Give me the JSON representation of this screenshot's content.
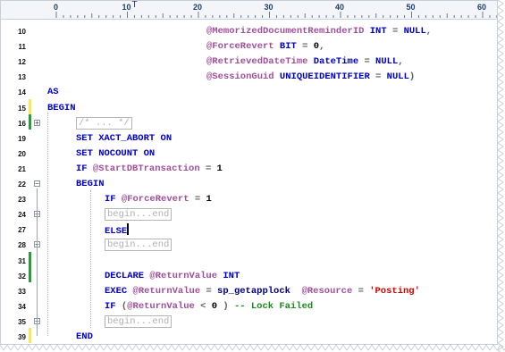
{
  "ruler": {
    "labels": [
      "0",
      "10",
      "20",
      "30",
      "40",
      "50",
      "60"
    ],
    "marker": "T"
  },
  "lines": [
    {
      "num": "10",
      "bar": "none",
      "fold": "",
      "indent": 230,
      "tokens": [
        {
          "c": "var",
          "t": "@MemorizedDocumentReminderID"
        },
        {
          "c": "kw",
          "t": " INT "
        },
        {
          "c": "op",
          "t": "="
        },
        {
          "c": "kw",
          "t": " NULL"
        },
        {
          "c": "op",
          "t": ","
        }
      ]
    },
    {
      "num": "11",
      "bar": "none",
      "fold": "",
      "indent": 230,
      "tokens": [
        {
          "c": "var",
          "t": "@ForceRevert"
        },
        {
          "c": "kw",
          "t": " BIT "
        },
        {
          "c": "op",
          "t": "="
        },
        {
          "c": "num",
          "t": " 0"
        },
        {
          "c": "op",
          "t": ","
        }
      ]
    },
    {
      "num": "12",
      "bar": "none",
      "fold": "",
      "indent": 230,
      "tokens": [
        {
          "c": "var",
          "t": "@RetrievedDateTime"
        },
        {
          "c": "kw",
          "t": " DateTime "
        },
        {
          "c": "op",
          "t": "="
        },
        {
          "c": "kw",
          "t": " NULL"
        },
        {
          "c": "op",
          "t": ","
        }
      ]
    },
    {
      "num": "13",
      "bar": "none",
      "fold": "",
      "indent": 230,
      "tokens": [
        {
          "c": "var",
          "t": "@SessionGuid"
        },
        {
          "c": "kw",
          "t": " UNIQUEIDENTIFIER "
        },
        {
          "c": "op",
          "t": "="
        },
        {
          "c": "kw",
          "t": " NULL"
        },
        {
          "c": "op",
          "t": ")"
        }
      ]
    },
    {
      "num": "14",
      "bar": "none",
      "fold": "",
      "indent": 52,
      "tokens": [
        {
          "c": "kw",
          "t": "AS"
        }
      ]
    },
    {
      "num": "15",
      "bar": "yellow",
      "fold": "",
      "indent": 52,
      "tokens": [
        {
          "c": "kw",
          "t": "BEGIN"
        }
      ]
    },
    {
      "num": "16",
      "bar": "green",
      "fold": "+",
      "indent": 84,
      "tokens": [
        {
          "c": "collapsed",
          "t": "/* ... */"
        }
      ]
    },
    {
      "num": "19",
      "bar": "none",
      "fold": "",
      "indent": 84,
      "tokens": [
        {
          "c": "kw",
          "t": "SET XACT_ABORT ON"
        }
      ]
    },
    {
      "num": "20",
      "bar": "none",
      "fold": "",
      "indent": 84,
      "tokens": [
        {
          "c": "kw",
          "t": "SET NOCOUNT ON"
        }
      ]
    },
    {
      "num": "21",
      "bar": "none",
      "fold": "",
      "indent": 84,
      "tokens": [
        {
          "c": "kw",
          "t": "IF "
        },
        {
          "c": "var",
          "t": "@StartDBTransaction"
        },
        {
          "c": "op",
          "t": " = "
        },
        {
          "c": "num",
          "t": "1"
        }
      ]
    },
    {
      "num": "22",
      "bar": "none",
      "fold": "-",
      "indent": 84,
      "tokens": [
        {
          "c": "kw",
          "t": "BEGIN"
        }
      ]
    },
    {
      "num": "23",
      "bar": "none",
      "fold": "",
      "indent": 116,
      "tokens": [
        {
          "c": "kw",
          "t": "IF "
        },
        {
          "c": "var",
          "t": "@ForceRevert"
        },
        {
          "c": "op",
          "t": " = "
        },
        {
          "c": "num",
          "t": "1"
        }
      ]
    },
    {
      "num": "24",
      "bar": "none",
      "fold": "+",
      "indent": 116,
      "tokens": [
        {
          "c": "collapsed",
          "t": "begin...end"
        }
      ]
    },
    {
      "num": "27",
      "bar": "none",
      "fold": "",
      "indent": 116,
      "tokens": [
        {
          "c": "kw",
          "t": "ELSE"
        },
        {
          "c": "caret",
          "t": ""
        }
      ]
    },
    {
      "num": "28",
      "bar": "none",
      "fold": "+",
      "indent": 116,
      "tokens": [
        {
          "c": "collapsed",
          "t": "begin...end"
        }
      ]
    },
    {
      "num": "31",
      "bar": "green",
      "fold": "",
      "indent": 116,
      "tokens": []
    },
    {
      "num": "32",
      "bar": "green",
      "fold": "",
      "indent": 116,
      "tokens": [
        {
          "c": "kw",
          "t": "DECLARE "
        },
        {
          "c": "var",
          "t": "@ReturnValue"
        },
        {
          "c": "kw",
          "t": " INT"
        }
      ]
    },
    {
      "num": "33",
      "bar": "none",
      "fold": "",
      "indent": 116,
      "tokens": [
        {
          "c": "kw",
          "t": "EXEC "
        },
        {
          "c": "var",
          "t": "@ReturnValue"
        },
        {
          "c": "op",
          "t": " = "
        },
        {
          "c": "txt",
          "t": "sp_getapplock  "
        },
        {
          "c": "var",
          "t": "@Resource"
        },
        {
          "c": "op",
          "t": " = "
        },
        {
          "c": "str",
          "t": "'Posting'"
        }
      ]
    },
    {
      "num": "34",
      "bar": "none",
      "fold": "",
      "indent": 116,
      "tokens": [
        {
          "c": "kw",
          "t": "IF "
        },
        {
          "c": "op",
          "t": "("
        },
        {
          "c": "var",
          "t": "@ReturnValue"
        },
        {
          "c": "op",
          "t": " < "
        },
        {
          "c": "num",
          "t": "0"
        },
        {
          "c": "op",
          "t": " ) "
        },
        {
          "c": "cmt",
          "t": "-- Lock Failed"
        }
      ]
    },
    {
      "num": "35",
      "bar": "none",
      "fold": "+",
      "indent": 116,
      "tokens": [
        {
          "c": "collapsed",
          "t": "begin...end"
        }
      ]
    },
    {
      "num": "39",
      "bar": "yellow",
      "fold": "",
      "indent": 84,
      "tokens": [
        {
          "c": "kw",
          "t": "END"
        }
      ]
    }
  ],
  "colors": {
    "yellow_bar": "#f5e95a",
    "green_bar": "#2a9a3c",
    "keyword": "#0000c8",
    "variable": "#a0509a",
    "string": "#d40000",
    "comment": "#1c8a1c"
  }
}
